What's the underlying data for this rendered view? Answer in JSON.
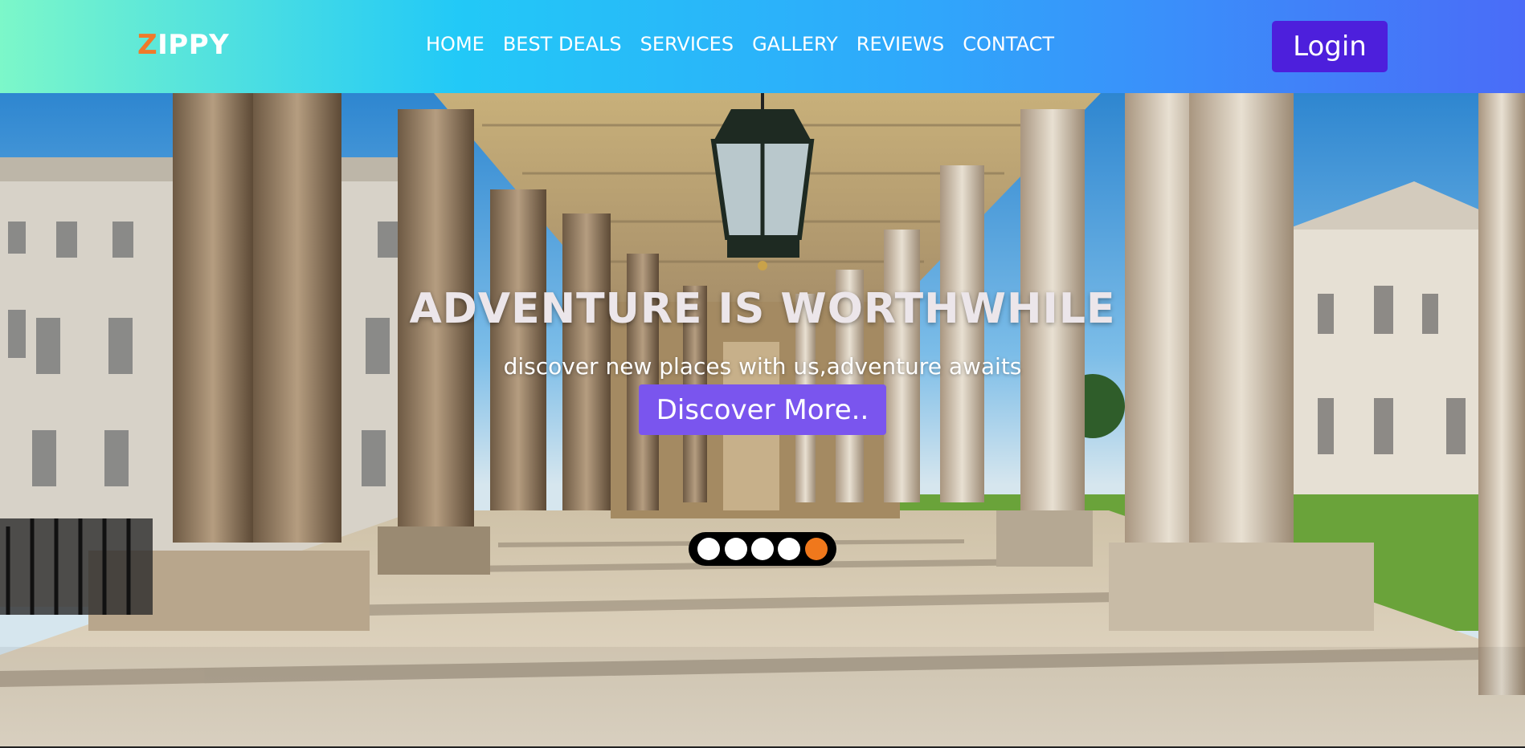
{
  "brand": {
    "first_letter": "Z",
    "rest": "IPPY"
  },
  "nav": {
    "items": [
      {
        "label": "HOME"
      },
      {
        "label": "BEST DEALS"
      },
      {
        "label": "SERVICES"
      },
      {
        "label": "GALLERY"
      },
      {
        "label": "REVIEWS"
      },
      {
        "label": "CONTACT"
      }
    ]
  },
  "login": {
    "label": "Login"
  },
  "hero": {
    "title": "ADVENTURE IS WORTHWHILE",
    "subtitle": "discover new places with us,adventure awaits",
    "cta_label": "Discover More..",
    "slides_total": 5,
    "active_slide": 5
  },
  "colors": {
    "header_gradient": [
      "#7cf7c9",
      "#22c9f7",
      "#2fa8fb",
      "#4a6cf8"
    ],
    "logo_accent": "#f07a2a",
    "login_bg": "#4d1fdc",
    "cta_bg": "#7a55ee",
    "active_dot": "#f0781c"
  }
}
